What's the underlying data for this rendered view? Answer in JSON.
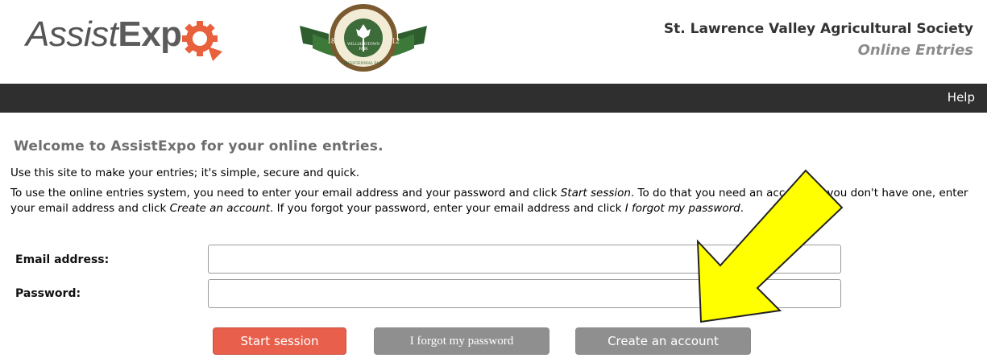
{
  "header": {
    "logo_assist": "Assist",
    "logo_expo": "Exp",
    "fair_logo_text_top": "WILLIAMSTOWN",
    "fair_logo_text_mid": "FAIR",
    "fair_logo_text_bottom": "BICENTENNIAL FAIR",
    "fair_logo_year_left": "18",
    "fair_logo_year_right": "12",
    "society_name": "St. Lawrence Valley Agricultural Society",
    "subtitle": "Online Entries"
  },
  "topbar": {
    "help_label": "Help"
  },
  "main": {
    "welcome": "Welcome to AssistExpo for your online entries.",
    "intro": "Use this site to make your entries; it's simple, secure and quick.",
    "instructions_1": "To use the online entries system, you need to enter your email address and your password and click ",
    "instructions_start": "Start session",
    "instructions_2": ". To do that you need an account; if you don't have one, enter your email address and click ",
    "instructions_create": "Create an account",
    "instructions_3": ". If you forgot your password, enter your email address and click ",
    "instructions_forgot": "I forgot my password",
    "instructions_4": "."
  },
  "form": {
    "email_label": "Email address:",
    "email_value": "",
    "password_label": "Password:",
    "password_value": ""
  },
  "buttons": {
    "start": "Start session",
    "forgot": "I forgot my password",
    "create": "Create an account"
  },
  "colors": {
    "topbar": "#2f2f2f",
    "start_button": "#e8604c",
    "secondary_button": "#8f8f8f",
    "logo_orange": "#e8603c",
    "arrow_yellow": "#ffff00"
  }
}
